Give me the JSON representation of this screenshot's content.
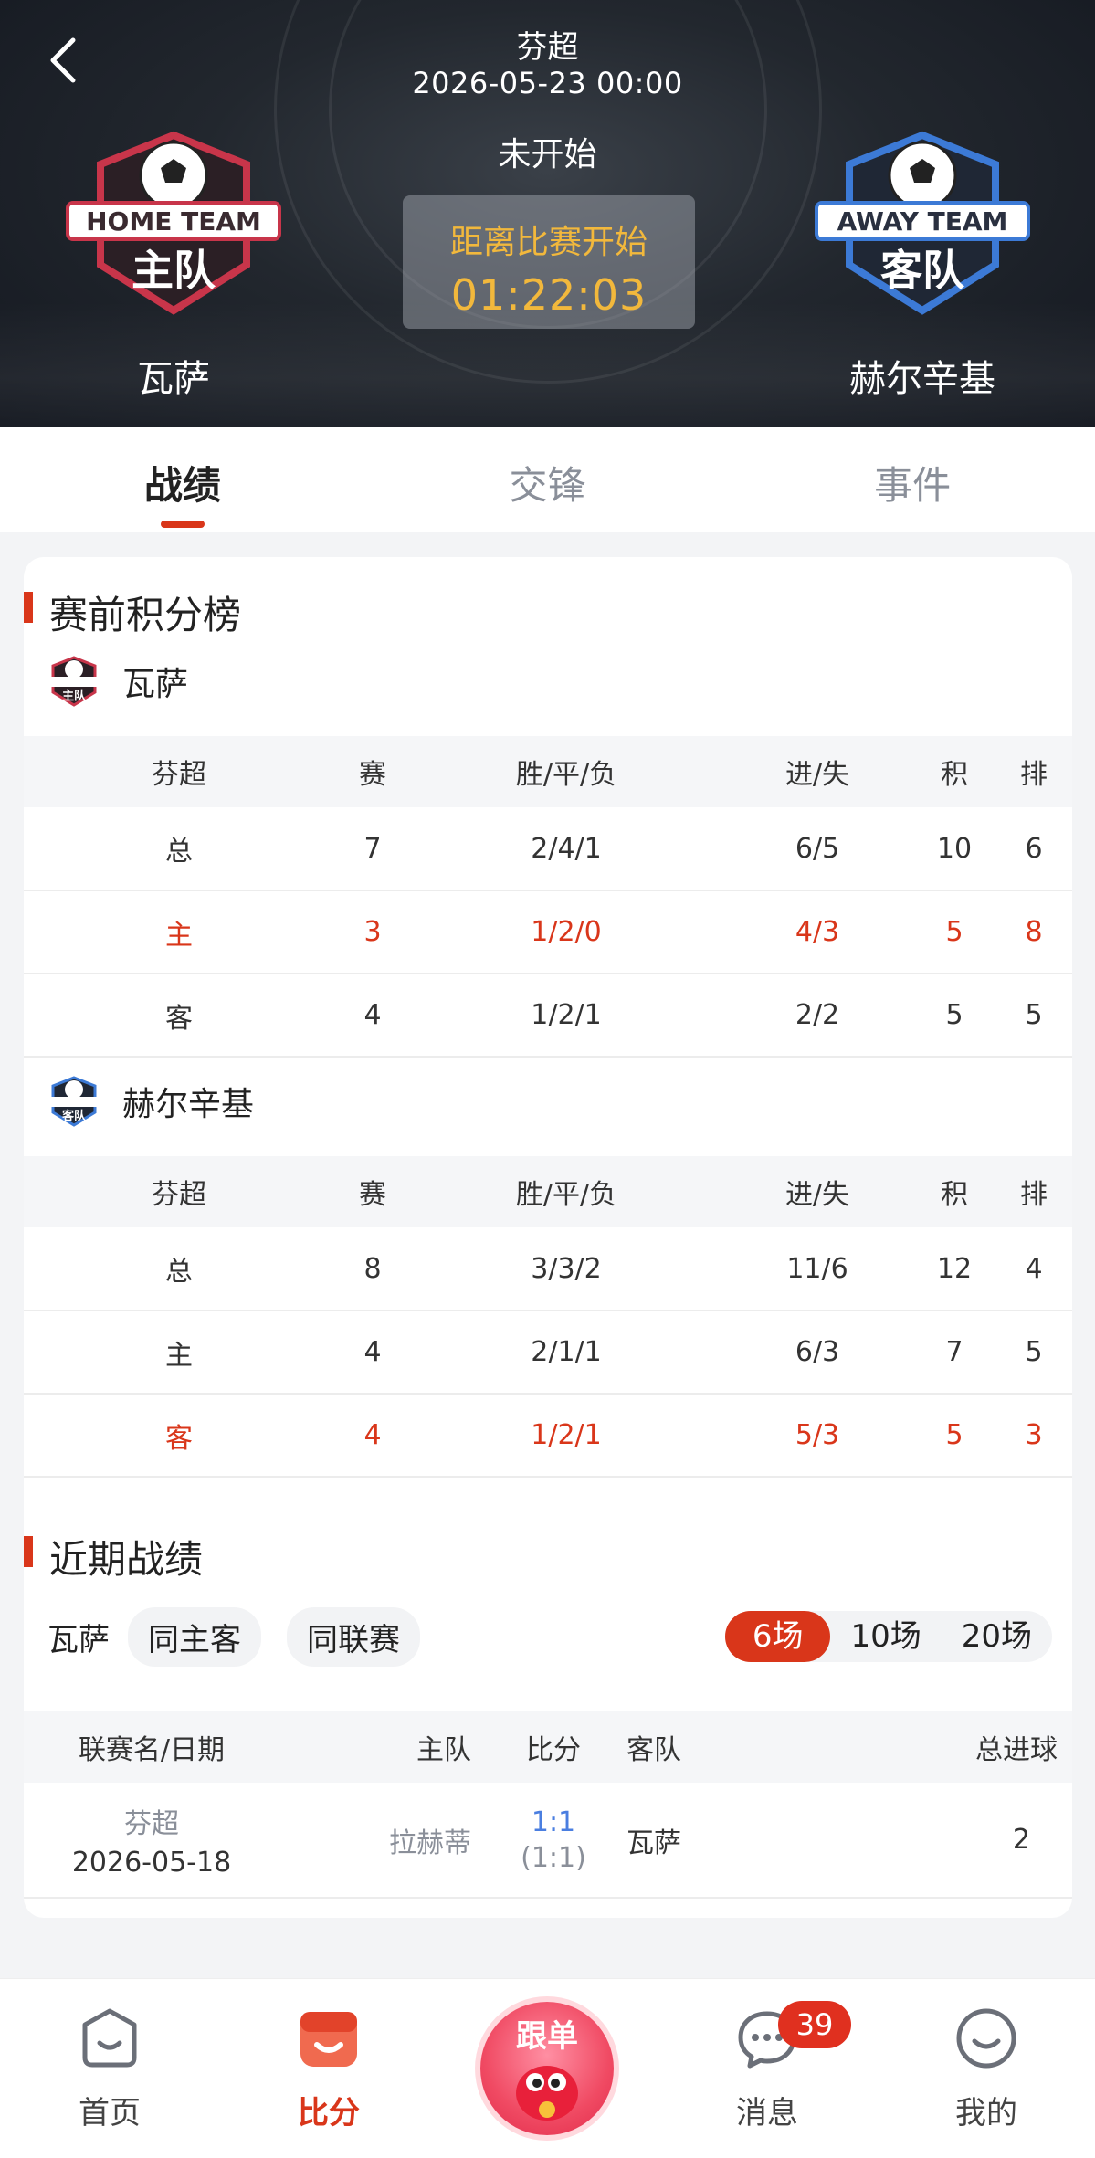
{
  "header": {
    "league": "芬超",
    "datetime": "2026-05-23 00:00",
    "status": "未开始",
    "countdown_label": "距离比赛开始",
    "countdown_time": "01:22:03",
    "home": {
      "name": "瓦萨",
      "logo_top": "HOME TEAM",
      "logo_main": "主队"
    },
    "away": {
      "name": "赫尔辛基",
      "logo_top": "AWAY TEAM",
      "logo_main": "客队"
    }
  },
  "tabs": [
    {
      "label": "战绩"
    },
    {
      "label": "交锋"
    },
    {
      "label": "事件"
    }
  ],
  "standings": {
    "title": "赛前积分榜",
    "headers": [
      "芬超",
      "赛",
      "胜/平/负",
      "进/失",
      "积",
      "排"
    ],
    "home_team": "瓦萨",
    "home_rows": [
      [
        "总",
        "7",
        "2/4/1",
        "6/5",
        "10",
        "6"
      ],
      [
        "主",
        "3",
        "1/2/0",
        "4/3",
        "5",
        "8"
      ],
      [
        "客",
        "4",
        "1/2/1",
        "2/2",
        "5",
        "5"
      ]
    ],
    "away_team": "赫尔辛基",
    "away_rows": [
      [
        "总",
        "8",
        "3/3/2",
        "11/6",
        "12",
        "4"
      ],
      [
        "主",
        "4",
        "2/1/1",
        "6/3",
        "7",
        "5"
      ],
      [
        "客",
        "4",
        "1/2/1",
        "5/3",
        "5",
        "3"
      ]
    ]
  },
  "recent": {
    "title": "近期战绩",
    "team": "瓦萨",
    "chips": [
      "同主客",
      "同联赛"
    ],
    "counts": [
      "6场",
      "10场",
      "20场"
    ],
    "headers": [
      "联赛名/日期",
      "主队",
      "比分",
      "客队",
      "总进球"
    ],
    "rows": [
      {
        "league": "芬超",
        "date": "2026-05-18",
        "home": "拉赫蒂",
        "score": "1:1",
        "half": "(1:1)",
        "away": "瓦萨",
        "total": "2"
      }
    ]
  },
  "nav": {
    "home": "首页",
    "score": "比分",
    "follow": "跟单",
    "messages": "消息",
    "messages_badge": "39",
    "mine": "我的"
  },
  "colors": {
    "accent": "#d9361a",
    "countdown": "#f2b83c",
    "link_blue": "#4a7ee0"
  }
}
